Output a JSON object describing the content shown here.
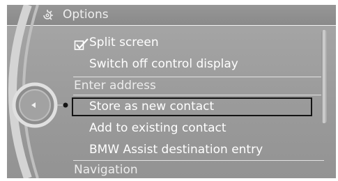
{
  "header": {
    "title": "Options",
    "icon": "options-gear-icon"
  },
  "menu": {
    "items": [
      {
        "label": "Split screen",
        "checked": true,
        "icon": "checkmark-icon"
      },
      {
        "label": "Switch off control display"
      },
      {
        "label": "Enter address",
        "section": true
      },
      {
        "label": "Store as new contact",
        "selected": true
      },
      {
        "label": "Add to existing contact"
      },
      {
        "label": "BMW Assist destination entry"
      },
      {
        "label": "Navigation",
        "section": true
      }
    ]
  },
  "controller": {
    "icon": "controller-left-arrow-icon"
  },
  "colors": {
    "background": "#a0a0a0",
    "header": "#8f8f8f",
    "text": "#ffffff",
    "selection_frame": "#141414"
  }
}
